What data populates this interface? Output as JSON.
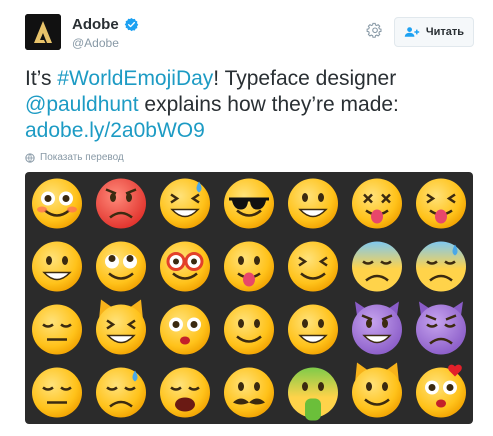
{
  "header": {
    "name": "Adobe",
    "handle": "@Adobe",
    "follow_label": "Читать"
  },
  "tweet": {
    "text_pre": "It’s ",
    "hashtag": "#WorldEmojiDay",
    "text_mid": "! Typeface designer ",
    "mention": "@pauldhunt",
    "text_post": " explains how they’re made:",
    "link": "adobe.ly/2a0bWO9",
    "translate_label": "Показать перевод"
  },
  "media": {
    "rows": 4,
    "cols": 7,
    "emojis": [
      [
        "flushed",
        "angry",
        "grin-sweat",
        "sunglasses",
        "zany",
        "dizzy-tongue",
        "wink-tongue"
      ],
      [
        "grin-teeth",
        "eye-roll",
        "nerd",
        "tongue",
        "squint",
        "cold",
        "cold-sweat"
      ],
      [
        "smirk",
        "cat-grin",
        "kiss-wink",
        "smile",
        "grimace",
        "devil",
        "devil-frown"
      ],
      [
        "neutral",
        "sad-sweat",
        "anguish",
        "mustache",
        "nauseated",
        "cat-smile",
        "heart-kiss"
      ]
    ]
  },
  "colors": {
    "link": "#2b7bb9",
    "hashtag": "#1d9bc4",
    "emoji_yellow": "#ffcc33",
    "background_media": "#2b2b2b"
  }
}
